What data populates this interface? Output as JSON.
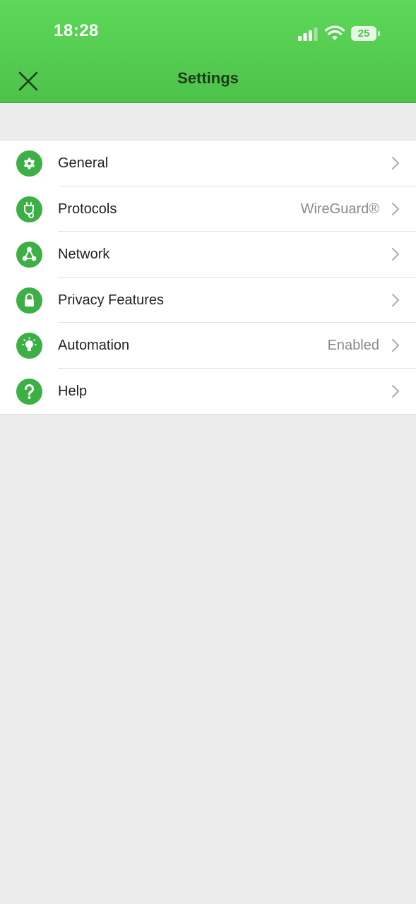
{
  "status_bar": {
    "time": "18:28",
    "battery": "25"
  },
  "header": {
    "title": "Settings",
    "close_icon": "close-icon"
  },
  "colors": {
    "header_green": "#4dc249",
    "icon_green": "#3cb044",
    "background": "#ececec"
  },
  "menu": {
    "items": [
      {
        "label": "General",
        "value": "",
        "icon": "gear-icon"
      },
      {
        "label": "Protocols",
        "value": "WireGuard®",
        "icon": "plug-icon"
      },
      {
        "label": "Network",
        "value": "",
        "icon": "network-icon"
      },
      {
        "label": "Privacy Features",
        "value": "",
        "icon": "lock-icon"
      },
      {
        "label": "Automation",
        "value": "Enabled",
        "icon": "lightbulb-icon"
      },
      {
        "label": "Help",
        "value": "",
        "icon": "question-icon"
      }
    ]
  }
}
